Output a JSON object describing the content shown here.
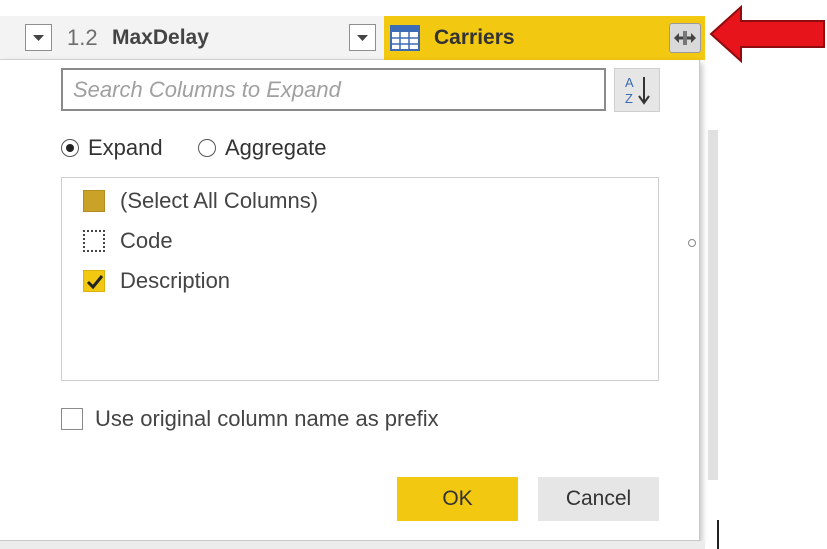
{
  "header": {
    "col1_type": "1.2",
    "col1_name": "MaxDelay",
    "col2_name": "Carriers"
  },
  "icons": {
    "dropdown": "chevron-down-icon",
    "table": "table-icon",
    "expand": "expand-column-icon",
    "sort": "sort-az-icon",
    "annotation": "red-arrow-icon"
  },
  "dialog": {
    "search_placeholder": "Search Columns to Expand",
    "mode_options": [
      {
        "label": "Expand",
        "selected": true
      },
      {
        "label": "Aggregate",
        "selected": false
      }
    ],
    "columns": [
      {
        "label": "(Select All Columns)",
        "state": "partial"
      },
      {
        "label": "Code",
        "state": "unchecked"
      },
      {
        "label": "Description",
        "state": "checked"
      }
    ],
    "prefix_label": "Use original column name as prefix",
    "prefix_checked": false,
    "ok_label": "OK",
    "cancel_label": "Cancel"
  },
  "colors": {
    "accent": "#f2c811",
    "annotation_red": "#e8141c"
  }
}
